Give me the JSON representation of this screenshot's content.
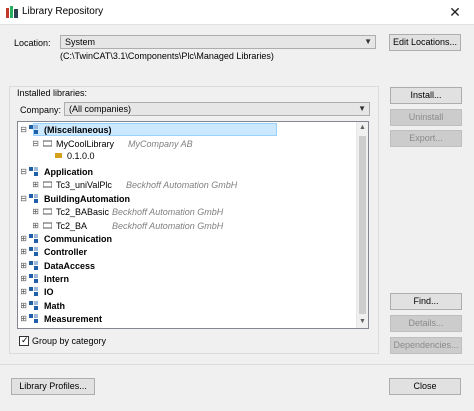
{
  "window": {
    "title": "Library Repository"
  },
  "location": {
    "label": "Location:",
    "value": "System",
    "path": "(C:\\TwinCAT\\3.1\\Components\\Plc\\Managed Libraries)",
    "edit_button": "Edit Locations..."
  },
  "installed": {
    "group_label": "Installed libraries:",
    "company_label": "Company:",
    "company_value": "(All companies)"
  },
  "tree": {
    "misc": "(Miscellaneous)",
    "mycool_name": "MyCoolLibrary",
    "mycool_vendor": "MyCompany AB",
    "mycool_version": "0.1.0.0",
    "application": "Application",
    "tc3_name": "Tc3_uniValPlc",
    "tc3_vendor": "Beckhoff Automation GmbH",
    "building": "BuildingAutomation",
    "babasic_name": "Tc2_BABasic",
    "babasic_vendor": "Beckhoff Automation GmbH",
    "ba_name": "Tc2_BA",
    "ba_vendor": "Beckhoff Automation GmbH",
    "communication": "Communication",
    "controller": "Controller",
    "dataaccess": "DataAccess",
    "intern": "Intern",
    "io": "IO",
    "math": "Math",
    "measurement": "Measurement"
  },
  "side_buttons": {
    "install": "Install...",
    "uninstall": "Uninstall",
    "export": "Export...",
    "find": "Find...",
    "details": "Details...",
    "dependencies": "Dependencies..."
  },
  "group_by": {
    "label": "Group by category",
    "checked": true
  },
  "footer": {
    "profiles": "Library Profiles...",
    "close": "Close"
  },
  "colors": {
    "selection": "#cce8ff",
    "icon_blue": "#1e5fa8"
  }
}
